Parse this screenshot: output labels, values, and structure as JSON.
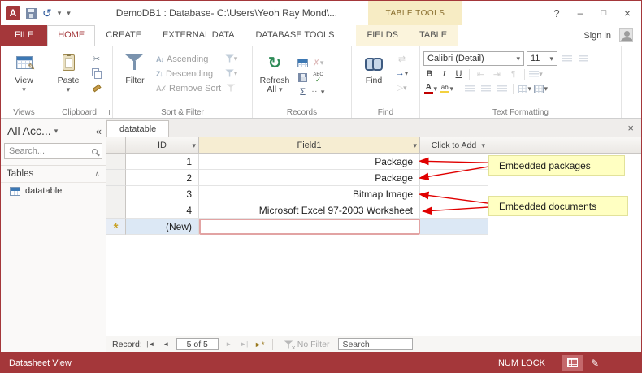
{
  "theme": {
    "accent": "#A4373A",
    "contextual_bg": "#F7ECC4",
    "annotation_bg": "#FFFFC2",
    "arrow": "#E00000"
  },
  "title_bar": {
    "title": "DemoDB1 : Database- C:\\Users\\Yeoh Ray Mond\\...",
    "context_label": "TABLE TOOLS"
  },
  "tabs": {
    "file": "FILE",
    "home": "HOME",
    "create": "CREATE",
    "external_data": "EXTERNAL DATA",
    "database_tools": "DATABASE TOOLS",
    "fields": "FIELDS",
    "table": "TABLE"
  },
  "account": {
    "sign_in": "Sign in"
  },
  "ribbon": {
    "views": {
      "label": "Views",
      "view": "View"
    },
    "clipboard": {
      "label": "Clipboard",
      "paste": "Paste"
    },
    "sort_filter": {
      "label": "Sort & Filter",
      "filter": "Filter",
      "ascending": "Ascending",
      "descending": "Descending",
      "remove_sort": "Remove Sort"
    },
    "records": {
      "label": "Records",
      "refresh_line1": "Refresh",
      "refresh_line2": "All"
    },
    "find": {
      "label": "Find",
      "find": "Find"
    },
    "text_formatting": {
      "label": "Text Formatting",
      "font_name": "Calibri (Detail)",
      "font_size": "11",
      "bold": "B",
      "italic": "I",
      "underline": "U"
    }
  },
  "nav_pane": {
    "title": "All Acc...",
    "search_placeholder": "Search...",
    "section_tables": "Tables",
    "items": [
      {
        "label": "datatable"
      }
    ]
  },
  "document": {
    "tab_label": "datatable"
  },
  "datasheet": {
    "columns": {
      "id": "ID",
      "field1": "Field1",
      "add": "Click to Add"
    },
    "rows": [
      {
        "id": "1",
        "field1": "Package"
      },
      {
        "id": "2",
        "field1": "Package"
      },
      {
        "id": "3",
        "field1": "Bitmap Image"
      },
      {
        "id": "4",
        "field1": "Microsoft Excel 97-2003 Worksheet"
      },
      {
        "id": "(New)",
        "field1": ""
      }
    ]
  },
  "annotations": [
    {
      "text": "Embedded packages"
    },
    {
      "text": "Embedded documents"
    }
  ],
  "record_nav": {
    "label": "Record:",
    "position": "5 of 5",
    "no_filter": "No Filter",
    "search_placeholder": "Search"
  },
  "status_bar": {
    "view": "Datasheet View",
    "num_lock": "NUM LOCK"
  }
}
